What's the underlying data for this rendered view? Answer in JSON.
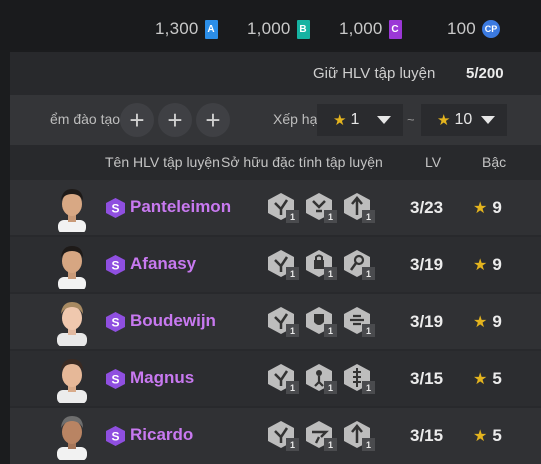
{
  "currencies": [
    {
      "value": "1,300",
      "badge": "A",
      "icon": "currency-a-icon"
    },
    {
      "value": "1,000",
      "badge": "B",
      "icon": "currency-b-icon"
    },
    {
      "value": "1,000",
      "badge": "C",
      "icon": "currency-c-icon"
    },
    {
      "value": "100",
      "badge": "CP",
      "icon": "cp-coin-icon"
    }
  ],
  "hold": {
    "label": "Giữ HLV tập luyện",
    "value": "5/200"
  },
  "filter": {
    "label": "ểm đào tạo",
    "rank_label": "Xếp hạ",
    "min": "1",
    "max": "10",
    "separator": "~"
  },
  "table": {
    "headers": {
      "name": "Tên HLV tập luyện",
      "traits": "Sở hữu đặc tính tập luyện",
      "lv": "LV",
      "grade": "Bậc"
    },
    "rows": [
      {
        "name": "Panteleimon",
        "lv": "3/23",
        "grade": "9",
        "trait_levels": [
          "1",
          "1",
          "1"
        ]
      },
      {
        "name": "Afanasy",
        "lv": "3/19",
        "grade": "9",
        "trait_levels": [
          "1",
          "1",
          "1"
        ]
      },
      {
        "name": "Boudewijn",
        "lv": "3/19",
        "grade": "9",
        "trait_levels": [
          "1",
          "1",
          "1"
        ]
      },
      {
        "name": "Magnus",
        "lv": "3/15",
        "grade": "5",
        "trait_levels": [
          "1",
          "1",
          "1"
        ]
      },
      {
        "name": "Ricardo",
        "lv": "3/15",
        "grade": "5",
        "trait_levels": [
          "1",
          "1",
          "1"
        ]
      }
    ],
    "rank_badge": "S"
  },
  "colors": {
    "accent_purple": "#c879f0",
    "star_gold": "#e4b41e"
  }
}
